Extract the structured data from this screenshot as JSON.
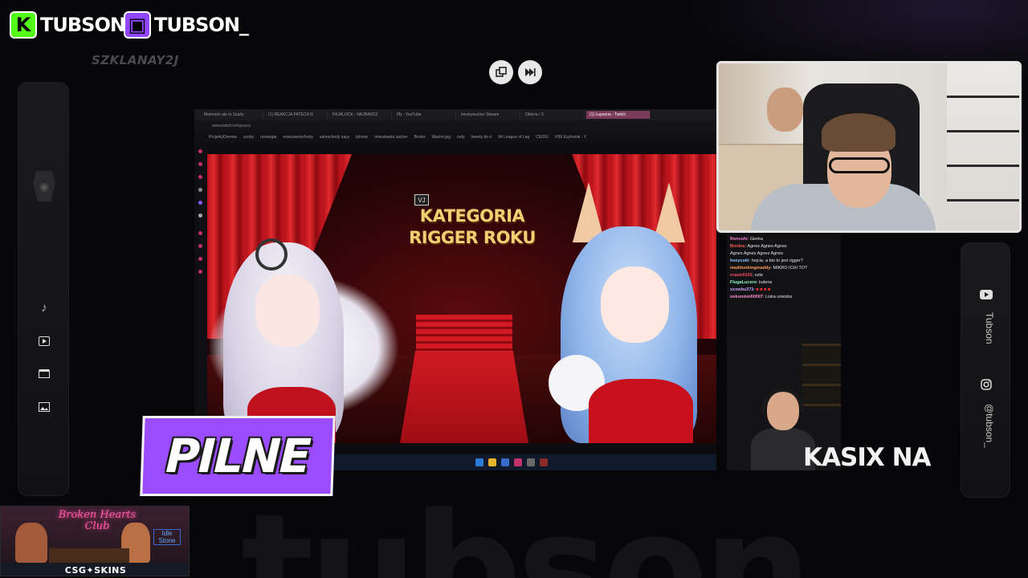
{
  "brand": {
    "kick": {
      "badge": "K",
      "name": "TUBSON"
    },
    "twitch": {
      "badge": "▣",
      "name": "TUBSON_"
    }
  },
  "watermark_tag": "SZKLANAY2J",
  "bg_watermark": "tubson",
  "media_controls": {
    "popout_icon": "popout-icon",
    "skip_icon": "skip-forward-icon"
  },
  "left_sidebar": {
    "icons": [
      "logo-icon",
      "music-note-icon",
      "play-video-icon",
      "clapperboard-icon",
      "image-icon"
    ]
  },
  "right_sidebar": {
    "youtube": {
      "icon": "youtube-icon",
      "label": "Tubson"
    },
    "instagram": {
      "icon": "instagram-icon",
      "label": "@tubson_"
    }
  },
  "browser": {
    "tabs": [
      "Mammón ale to Szarly",
      "(1) REAKCJA PATECA N",
      "PAJALOCK - NAJBARDZ",
      "Iffy - YouTube",
      "mixerysucher Stream",
      "Okleva / X",
      "(1) Lupsoria - Twitch"
    ],
    "active_tab": 6,
    "url": "www.twitch.tv/lupsora",
    "bookmarks": [
      "ProjektyDomow",
      "szoby",
      "norwegia",
      "nowosamochody",
      "samochody xays",
      "iphone",
      "mieszkania sacher",
      "Books",
      "Ważne jpg",
      "rudy",
      "tweety do ri",
      "94 League of Leg",
      "CEIDG",
      "H36 Ecphorial - Y"
    ]
  },
  "stream": {
    "title_line1": "KATEGORIA",
    "title_line2": "RIGGER ROKU",
    "overlay_logo": "VJ"
  },
  "chat": {
    "messages": [
      {
        "user": "Renoshi",
        "text": "Gierka"
      },
      {
        "user": "Bonlos",
        "text": "Agnes Agnes Agnes"
      },
      {
        "user": "",
        "text": "Agnes Agnes Agnes Agnes"
      },
      {
        "user": "heeycuki",
        "text": "hejcia, a kto to jest rigger?"
      },
      {
        "user": "maddonkingmaddy",
        "text": "MIKRO ICHI TO?"
      },
      {
        "user": "crazie0101",
        "text": "szte"
      },
      {
        "user": "FlugaLucero",
        "text": "ludens"
      },
      {
        "user": "xxxwbu373",
        "text": ""
      },
      {
        "user": "nekomimi00007",
        "text": "Liska urwiska"
      }
    ],
    "colors": [
      "#ff7bd0",
      "#ff5b5b",
      "#ffffff",
      "#8fc7ff",
      "#ff9f5a",
      "#ff4d6a",
      "#8affc1",
      "#c9a2ff",
      "#ff8fd1"
    ]
  },
  "ticker": {
    "text": "KASIX NA E"
  },
  "pilne": {
    "text": "PILNE"
  },
  "sponsor": {
    "club_name": "Broken Hearts Club",
    "neon_sign": "Idle Stone",
    "label": "CSG✦SKINS"
  },
  "colors": {
    "kick_green": "#53fc18",
    "twitch_purple": "#9146ff",
    "pilne_purple": "#9b4cff",
    "stream_gold": "#f2cf73",
    "curtain_red": "#d11a22"
  }
}
